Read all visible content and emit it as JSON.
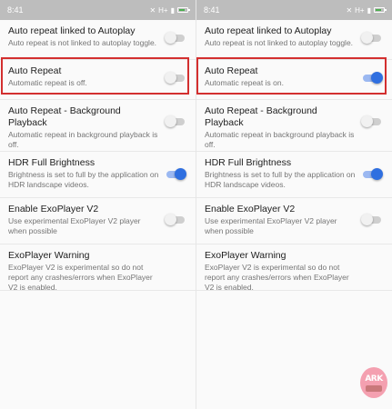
{
  "status": {
    "time": "8:41",
    "network": "H+",
    "signal_icon": "signal-icon",
    "battery_icon": "battery-icon"
  },
  "accent_color": "#2f6fe0",
  "highlight_color": "#d32f2f",
  "panels": [
    {
      "settings": [
        {
          "title": "Auto repeat linked to Autoplay",
          "summary": "Auto repeat is not linked to autoplay toggle.",
          "enabled": false
        },
        {
          "title": "Auto Repeat",
          "summary": "Automatic repeat is off.",
          "enabled": false
        },
        {
          "title": "Auto Repeat - Background Playback",
          "summary": "Automatic repeat in background playback is off.",
          "enabled": false
        },
        {
          "title": "HDR Full Brightness",
          "summary": "Brightness is set to full by the application on HDR landscape videos.",
          "enabled": true
        },
        {
          "title": "Enable ExoPlayer V2",
          "summary": "Use experimental ExoPlayer V2 player when possible",
          "enabled": false
        },
        {
          "title": "ExoPlayer Warning",
          "summary": "ExoPlayer V2 is experimental so do not report any crashes/errors when ExoPlayer V2 is enabled."
        }
      ]
    },
    {
      "settings": [
        {
          "title": "Auto repeat linked to Autoplay",
          "summary": "Auto repeat is not linked to autoplay toggle.",
          "enabled": false
        },
        {
          "title": "Auto Repeat",
          "summary": "Automatic repeat is on.",
          "enabled": true
        },
        {
          "title": "Auto Repeat - Background Playback",
          "summary": "Automatic repeat in background playback is off.",
          "enabled": false
        },
        {
          "title": "HDR Full Brightness",
          "summary": "Brightness is set to full by the application on HDR landscape videos.",
          "enabled": true
        },
        {
          "title": "Enable ExoPlayer V2",
          "summary": "Use experimental ExoPlayer V2 player when possible",
          "enabled": false
        },
        {
          "title": "ExoPlayer Warning",
          "summary": "ExoPlayer V2 is experimental so do not report any crashes/errors when ExoPlayer V2 is enabled."
        }
      ]
    }
  ],
  "watermark": {
    "text": "ARK"
  }
}
